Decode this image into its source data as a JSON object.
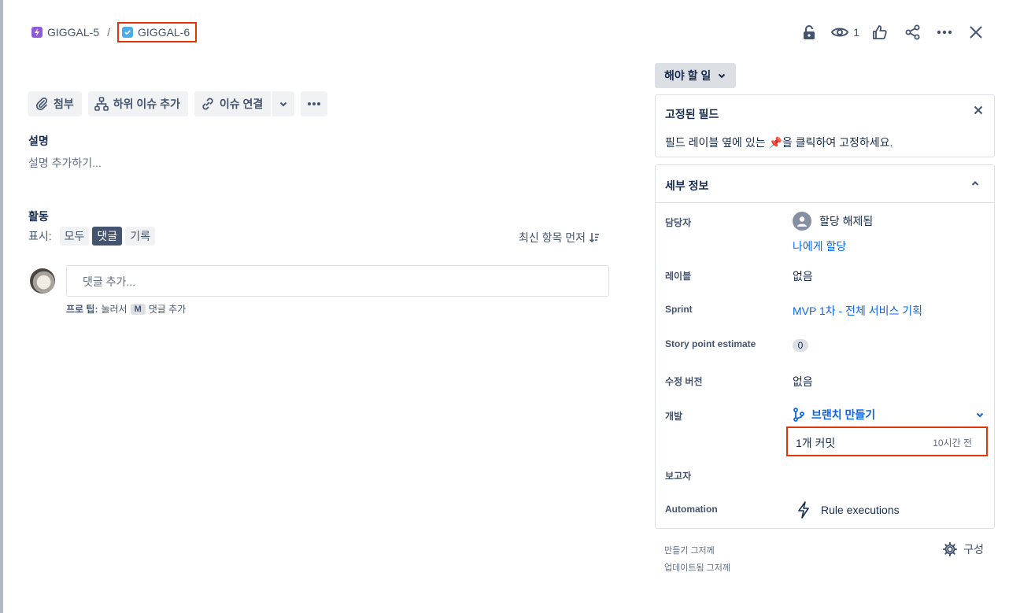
{
  "breadcrumb": {
    "parent": "GIGGAL-5",
    "separator": "/",
    "current": "GIGGAL-6"
  },
  "header": {
    "watch_count": "1",
    "icons": [
      "unlock-icon",
      "eye-icon",
      "thumbs-up-icon",
      "share-icon",
      "more-icon",
      "close-icon"
    ]
  },
  "toolbar": {
    "attach": "첨부",
    "add_child": "하위 이슈 추가",
    "link_issue": "이슈 연결"
  },
  "description": {
    "label": "설명",
    "placeholder": "설명 추가하기..."
  },
  "activity": {
    "label": "활동",
    "show_label": "표시:",
    "filters": [
      "모두",
      "댓글",
      "기록"
    ],
    "active_filter": "댓글",
    "sort": "최신 항목 먼저",
    "comment_placeholder": "댓글 추가...",
    "protip_prefix": "프로 팁:",
    "protip_press": "눌러서",
    "protip_key": "M",
    "protip_suffix": "댓글 추가"
  },
  "status": {
    "label": "해야 할 일"
  },
  "pinned": {
    "title": "고정된 필드",
    "body": "필드 레이블 옆에 있는 📌을 클릭하여 고정하세요."
  },
  "details": {
    "title": "세부 정보",
    "assignee_label": "담당자",
    "assignee_value": "할당 해제됨",
    "assign_to_me": "나에게 할당",
    "labels_label": "레이블",
    "labels_value": "없음",
    "sprint_label": "Sprint",
    "sprint_value": "MVP 1차 - 전체 서비스 기획",
    "story_points_label": "Story point estimate",
    "story_points_value": "0",
    "fix_version_label": "수정 버전",
    "fix_version_value": "없음",
    "development_label": "개발",
    "create_branch": "브랜치 만들기",
    "commits": "1개 커밋",
    "commit_time": "10시간 전",
    "reporter_label": "보고자",
    "automation_label": "Automation",
    "automation_value": "Rule executions"
  },
  "footer": {
    "created": "만들기 그저께",
    "updated": "업데이트됨 그저께",
    "configure": "구성"
  },
  "colors": {
    "accent": "#0c66e4",
    "highlight_border": "#de350b",
    "epic": "#8f5cd6",
    "task": "#4bade8"
  }
}
